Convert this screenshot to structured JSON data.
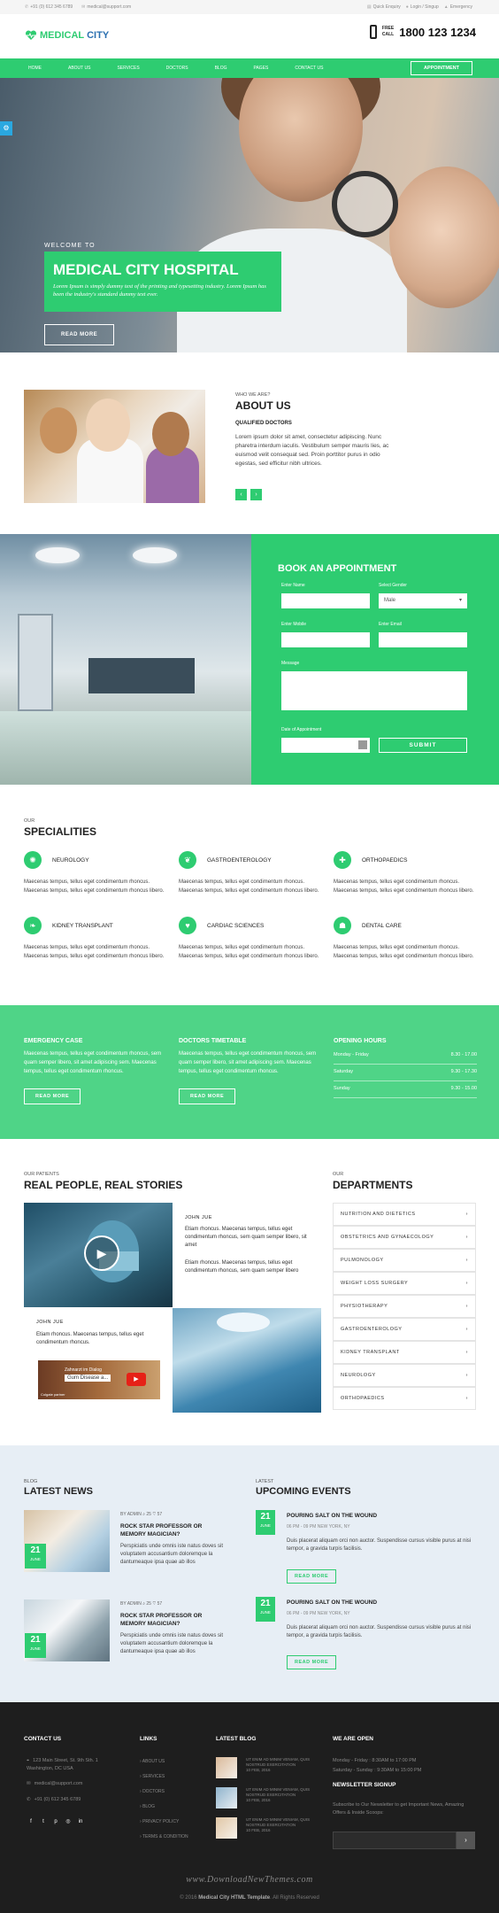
{
  "topbar": {
    "phone": "+91 (0) 612 345 6789",
    "email": "medical@support.com",
    "quick_enquiry": "Quick Enquiry",
    "login_signup": "Login / Singup",
    "emergency": "Emergency"
  },
  "header": {
    "logo_medical": "MEDICAL",
    "logo_city": "CITY",
    "free_call_1": "FREE",
    "free_call_2": "CALL",
    "phone_number": "1800 123 1234"
  },
  "nav": {
    "items": [
      "HOME",
      "ABOUT US",
      "SERVICES",
      "DOCTORS",
      "BLOG",
      "PAGES",
      "CONTACT US"
    ],
    "appointment": "APPOINTMENT"
  },
  "hero": {
    "welcome": "WELCOME TO",
    "title": "MEDICAL CITY HOSPITAL",
    "text": "Lorem Ipsum is simply dummy text of the printing and typesetting industry. Lorem Ipsum has been the industry's standard dummy text ever.",
    "button": "READ MORE"
  },
  "about": {
    "who": "WHO WE ARE?",
    "title": "ABOUT US",
    "subtitle": "QUALIFIED DOCTORS",
    "text": "Lorem ipsum dolor sit amet, consectetur adipiscing. Nunc pharetra interdum iaculis. Vestibulum semper mauris lies, ac euismod velit consequat sed. Proin porttitor purus in odio egestas, sed efficitur nibh ultrices.",
    "prev": "‹",
    "next": "›"
  },
  "booking": {
    "title": "BOOK AN APPOINTMENT",
    "name_label": "Enter Name",
    "gender_label": "Select Gender",
    "gender_value": "Male",
    "mobile_label": "Enter Mobile",
    "email_label": "Enter Email",
    "message_label": "Message",
    "date_label": "Date of Appointment",
    "submit": "SUBMIT"
  },
  "specialities": {
    "our": "OUR",
    "title": "SPECIALITIES",
    "items": [
      {
        "name": "NEUROLOGY",
        "text": "Maecenas tempus, tellus eget condimentum rhoncus. Maecenas tempus, tellus eget condimentum rhoncus libero.",
        "icon": "brain-icon"
      },
      {
        "name": "GASTROENTEROLOGY",
        "text": "Maecenas tempus, tellus eget condimentum rhoncus. Maecenas tempus, tellus eget condimentum rhoncus libero.",
        "icon": "stomach-icon"
      },
      {
        "name": "ORTHOPAEDICS",
        "text": "Maecenas tempus, tellus eget condimentum rhoncus. Maecenas tempus, tellus eget condimentum rhoncus libero.",
        "icon": "bone-icon"
      },
      {
        "name": "KIDNEY TRANSPLANT",
        "text": "Maecenas tempus, tellus eget condimentum rhoncus. Maecenas tempus, tellus eget condimentum rhoncus libero.",
        "icon": "kidney-icon"
      },
      {
        "name": "CARDIAC SCIENCES",
        "text": "Maecenas tempus, tellus eget condimentum rhoncus. Maecenas tempus, tellus eget condimentum rhoncus libero.",
        "icon": "heart-icon"
      },
      {
        "name": "DENTAL CARE",
        "text": "Maecenas tempus, tellus eget condimentum rhoncus. Maecenas tempus, tellus eget condimentum rhoncus libero.",
        "icon": "tooth-icon"
      }
    ]
  },
  "info": {
    "emergency_title": "EMERGENCY CASE",
    "emergency_text": "Maecenas tempus, tellus eget condimentum rhoncus, sem quam semper libero, sit amet adipiscing sem. Maecenas tempus, tellus eget condimentum rhoncus.",
    "emergency_button": "READ MORE",
    "timetable_title": "DOCTORS TIMETABLE",
    "timetable_text": "Maecenas tempus, tellus eget condimentum rhoncus, sem quam semper libero, sit amet adipiscing sem. Maecenas tempus, tellus eget condimentum rhoncus.",
    "timetable_button": "READ MORE",
    "hours_title": "OPENING HOURS",
    "hours": [
      {
        "day": "Monday - Friday",
        "time": "8.30 - 17.00"
      },
      {
        "day": "Saturday",
        "time": "9.30 - 17.30"
      },
      {
        "day": "Sunday",
        "time": "9.30 - 15.00"
      }
    ]
  },
  "stories": {
    "our": "OUR PATIENTS",
    "title": "REAL PEOPLE, REAL STORIES",
    "name1": "JOHN JUE",
    "text1a": "Etiam rhoncus. Maecenas tempus, tellus eget condimentum rhoncus, sem quam semper libero, sit amet",
    "text1b": "Etiam rhoncus. Maecenas tempus, tellus eget condimentum rhoncus, sem quam semper libero",
    "name2": "JOHN JUE",
    "text2": "Etiam rhoncus. Maecenas tempus, tellus eget condimentum rhoncus.",
    "video_title": "Gum Disease a...",
    "video_channel": "Zahnarzt im Dialog",
    "video_caption": "Colgate partner"
  },
  "departments": {
    "our": "OUR",
    "title": "DEPARTMENTS",
    "items": [
      "NUTRITION AND DIETETICS",
      "OBSTETRICS AND GYNAECOLOGY",
      "PULMONOLOGY",
      "WEIGHT LOSS SURGERY",
      "PHYSIOTHERAPY",
      "GASTROENTEROLOGY",
      "KIDNEY TRANSPLANT",
      "NEUROLOGY",
      "ORTHOPAEDICS"
    ]
  },
  "news": {
    "our": "BLOG",
    "title": "LATEST NEWS",
    "items": [
      {
        "day": "21",
        "month": "JUNE",
        "meta": "BY  ADMIN   ⌕ 25   ♡ 57",
        "title": "ROCK STAR PROFESSOR OR MEMORY MAGICIAN?",
        "text": "Perspiciatis unde omnis iste natus doves sit voluptatem accusantium doloremque la dantumeaque ipsa quae ab illos"
      },
      {
        "day": "21",
        "month": "JUNE",
        "meta": "BY  ADMIN   ⌕ 25   ♡ 57",
        "title": "ROCK STAR PROFESSOR OR MEMORY MAGICIAN?",
        "text": "Perspiciatis unde omnis iste natus doves sit voluptatem accusantium doloremque la dantumeaque ipsa quae ab illos"
      }
    ]
  },
  "events": {
    "our": "LATEST",
    "title": "UPCOMING EVENTS",
    "items": [
      {
        "day": "21",
        "month": "JUNE",
        "title": "POURING SALT ON THE WOUND",
        "meta": "06 PM - 09 PM        NEW YORK, NY",
        "text": "Duis placerat aliquam orci non auctor. Suspendisse cursus visible purus at nisi tempor, a gravida turpis facilisis.",
        "button": "READ MORE"
      },
      {
        "day": "21",
        "month": "JUNE",
        "title": "POURING SALT ON THE WOUND",
        "meta": "06 PM - 09 PM        NEW YORK, NY",
        "text": "Duis placerat aliquam orci non auctor. Suspendisse cursus visible purus at nisi tempor, a gravida turpis facilisis.",
        "button": "READ MORE"
      }
    ]
  },
  "footer": {
    "contact_title": "CONTACT US",
    "address": "123 Main Street, St. 9th Sth. 1 Washington, DC USA",
    "email": "medical@support.com",
    "phone": "+91 (0) 612 345 6789",
    "links_title": "LINKS",
    "links": [
      "ABOUT US",
      "SERVICES",
      "DOCTORS",
      "BLOG",
      "PRIVACY POLICY",
      "TERMS & CONDITION"
    ],
    "blog_title": "LATEST BLOG",
    "blog_items": [
      {
        "text": "UT ENIM AD MINIM VENIAM, QUIS NOSTRUD EXERCITATION",
        "date": "10 FEB, 2016"
      },
      {
        "text": "UT ENIM AD MINIM VENIAM, QUIS NOSTRUD EXERCITATION",
        "date": "10 FEB, 2016"
      },
      {
        "text": "UT ENIM AD MINIM VENIAM, QUIS NOSTRUD EXERCITATION",
        "date": "10 FEB, 2016"
      }
    ],
    "open_title": "WE ARE OPEN",
    "open_1": "Monday - Friday : 8:30AM to 17:00 PM",
    "open_2": "Saturday - Sunday : 9:30AM to 15:00 PM",
    "newsletter_title": "NEWSLETTER SIGNUP",
    "newsletter_text": "Subscribe to Our Newsletter to get Important News, Amazing Offers & Inside Scoops:",
    "newsletter_button": "›",
    "watermark": "www.DownloadNewThemes.com",
    "copy_prefix": "© 2016 ",
    "copy_brand": "Medical City HTML Template",
    "copy_suffix": ". All Rights Reserved"
  },
  "colors": {
    "accent": "#2ecc71",
    "dark": "#1e1e1e",
    "light_bg": "#e7eef5"
  }
}
